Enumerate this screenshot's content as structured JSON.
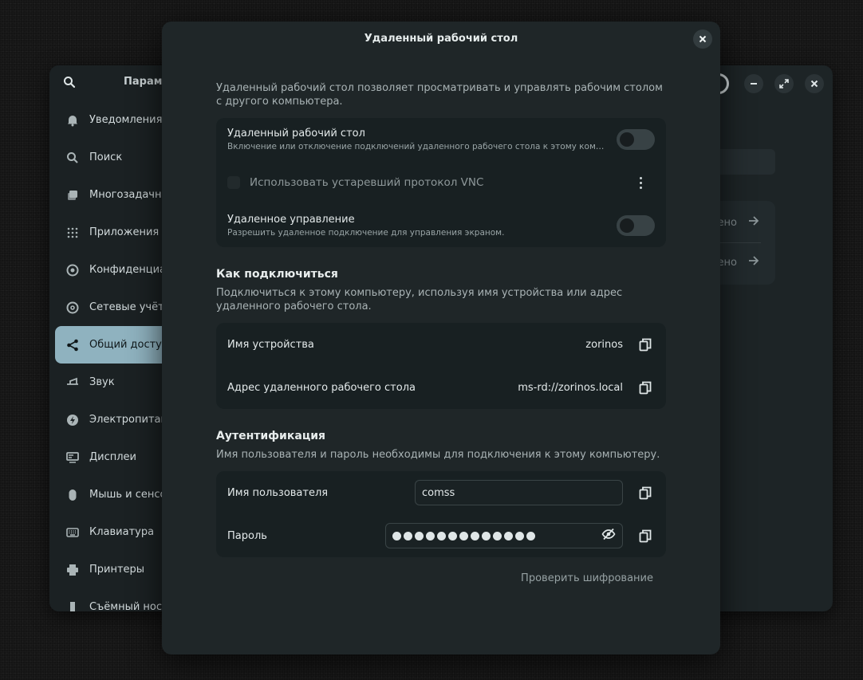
{
  "background_window": {
    "title": "Парам",
    "sidebar": [
      {
        "label": "Уведомления",
        "icon": "bell-icon"
      },
      {
        "label": "Поиск",
        "icon": "search-icon"
      },
      {
        "label": "Многозадачнос",
        "icon": "multitasking-icon"
      },
      {
        "label": "Приложения",
        "icon": "apps-grid-icon"
      },
      {
        "label": "Конфиденциал",
        "icon": "privacy-icon"
      },
      {
        "label": "Сетевые учёт",
        "icon": "online-accounts-icon"
      },
      {
        "label": "Общий доступ",
        "icon": "share-icon",
        "active": true
      },
      {
        "label": "Звук",
        "icon": "sound-icon"
      },
      {
        "label": "Электропитан",
        "icon": "power-icon"
      },
      {
        "label": "Дисплеи",
        "icon": "display-icon"
      },
      {
        "label": "Мышь и сенсо",
        "icon": "mouse-icon"
      },
      {
        "label": "Клавиатура",
        "icon": "keyboard-icon"
      },
      {
        "label": "Принтеры",
        "icon": "printer-icon"
      },
      {
        "label": "Съёмный нос",
        "icon": "removable-media-icon"
      }
    ],
    "card_rows": [
      {
        "value": "ено"
      },
      {
        "value": "ено"
      }
    ]
  },
  "dialog": {
    "title": "Удаленный рабочий стол",
    "intro": "Удаленный рабочий стол позволяет просматривать и управлять рабочим столом с другого компьютера.",
    "remote_desktop": {
      "title": "Удаленный рабочий стол",
      "subtitle": "Включение или отключение подключений удаленного рабочего стола к этому компьютеру",
      "enabled": false
    },
    "vnc": {
      "label": "Использовать устаревший протокол VNC",
      "checked": false
    },
    "remote_control": {
      "title": "Удаленное управление",
      "subtitle": "Разрешить удаленное подключение для управления экраном.",
      "enabled": false
    },
    "how_to_connect": {
      "title": "Как подключиться",
      "desc": "Подключиться к этому компьютеру, используя имя устройства или адрес удаленного рабочего стола.",
      "rows": [
        {
          "label": "Имя устройства",
          "value": "zorinos"
        },
        {
          "label": "Адрес удаленного рабочего стола",
          "value": "ms-rd://zorinos.local"
        }
      ]
    },
    "auth": {
      "title": "Аутентификация",
      "desc": "Имя пользователя и пароль необходимы для подключения к этому компьютеру.",
      "username_label": "Имя пользователя",
      "username_value": "comss",
      "password_label": "Пароль",
      "password_length": 13
    },
    "verify_encryption": "Проверить шифрование"
  }
}
